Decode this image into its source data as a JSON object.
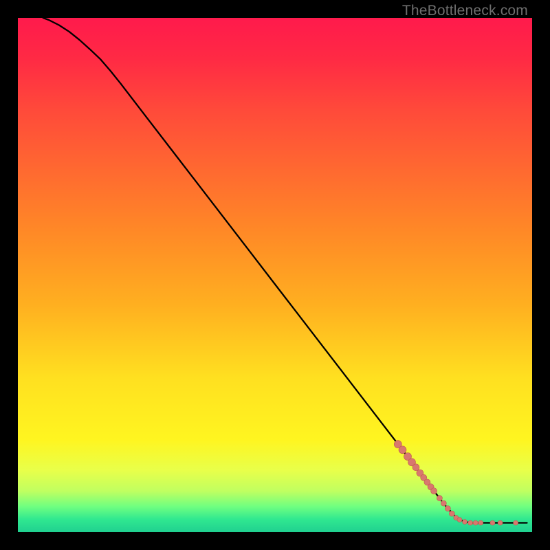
{
  "watermark": "TheBottleneck.com",
  "colors": {
    "background": "#000000",
    "curve": "#000000",
    "marker_fill": "#d8786e",
    "marker_stroke": "#c1584f"
  },
  "chart_data": {
    "type": "line",
    "title": "",
    "xlabel": "",
    "ylabel": "",
    "xlim": [
      0,
      100
    ],
    "ylim": [
      0,
      100
    ],
    "curve": [
      {
        "x": 4.9,
        "y": 100.0
      },
      {
        "x": 6.0,
        "y": 99.6
      },
      {
        "x": 8.0,
        "y": 98.6
      },
      {
        "x": 10.0,
        "y": 97.3
      },
      {
        "x": 12.0,
        "y": 95.7
      },
      {
        "x": 14.0,
        "y": 93.9
      },
      {
        "x": 16.0,
        "y": 92.0
      },
      {
        "x": 18.0,
        "y": 89.7
      },
      {
        "x": 20.0,
        "y": 87.2
      },
      {
        "x": 25.0,
        "y": 80.7
      },
      {
        "x": 30.0,
        "y": 74.2
      },
      {
        "x": 35.0,
        "y": 67.7
      },
      {
        "x": 40.0,
        "y": 61.2
      },
      {
        "x": 45.0,
        "y": 54.7
      },
      {
        "x": 50.0,
        "y": 48.2
      },
      {
        "x": 55.0,
        "y": 41.7
      },
      {
        "x": 60.0,
        "y": 35.2
      },
      {
        "x": 65.0,
        "y": 28.7
      },
      {
        "x": 70.0,
        "y": 22.2
      },
      {
        "x": 75.0,
        "y": 15.7
      },
      {
        "x": 80.0,
        "y": 9.2
      },
      {
        "x": 83.0,
        "y": 5.3
      },
      {
        "x": 85.0,
        "y": 3.1
      },
      {
        "x": 86.0,
        "y": 2.4
      },
      {
        "x": 87.0,
        "y": 2.0
      },
      {
        "x": 88.0,
        "y": 1.8
      },
      {
        "x": 90.0,
        "y": 1.8
      },
      {
        "x": 95.0,
        "y": 1.8
      },
      {
        "x": 99.0,
        "y": 1.8
      }
    ],
    "markers": [
      {
        "x": 73.9,
        "y": 17.1,
        "r": 5.5
      },
      {
        "x": 74.8,
        "y": 16.0,
        "r": 5.5
      },
      {
        "x": 75.8,
        "y": 14.7,
        "r": 5.5
      },
      {
        "x": 76.6,
        "y": 13.6,
        "r": 5.5
      },
      {
        "x": 77.4,
        "y": 12.6,
        "r": 5.0
      },
      {
        "x": 78.2,
        "y": 11.5,
        "r": 5.0
      },
      {
        "x": 78.9,
        "y": 10.6,
        "r": 4.5
      },
      {
        "x": 79.6,
        "y": 9.7,
        "r": 4.5
      },
      {
        "x": 80.3,
        "y": 8.8,
        "r": 4.5
      },
      {
        "x": 80.9,
        "y": 8.0,
        "r": 4.5
      },
      {
        "x": 82.0,
        "y": 6.6,
        "r": 4.0
      },
      {
        "x": 82.8,
        "y": 5.6,
        "r": 4.0
      },
      {
        "x": 83.6,
        "y": 4.6,
        "r": 4.0
      },
      {
        "x": 84.4,
        "y": 3.6,
        "r": 4.0
      },
      {
        "x": 85.2,
        "y": 2.8,
        "r": 3.5
      },
      {
        "x": 85.9,
        "y": 2.4,
        "r": 3.5
      },
      {
        "x": 86.9,
        "y": 2.0,
        "r": 3.5
      },
      {
        "x": 88.0,
        "y": 1.8,
        "r": 3.5
      },
      {
        "x": 89.0,
        "y": 1.8,
        "r": 3.5
      },
      {
        "x": 90.0,
        "y": 1.8,
        "r": 3.5
      },
      {
        "x": 92.3,
        "y": 1.8,
        "r": 3.5
      },
      {
        "x": 93.8,
        "y": 1.8,
        "r": 3.5
      },
      {
        "x": 96.8,
        "y": 1.8,
        "r": 3.5
      }
    ]
  }
}
